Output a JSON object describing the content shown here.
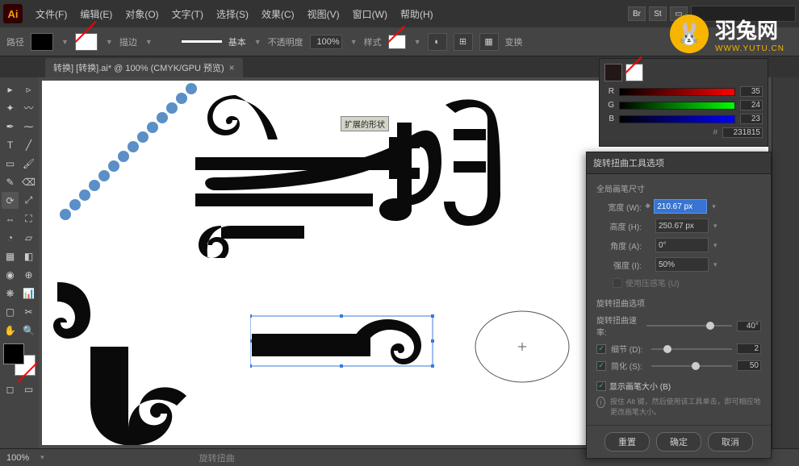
{
  "app": {
    "icon_label": "Ai"
  },
  "menus": {
    "file": "文件(F)",
    "edit": "编辑(E)",
    "object": "对象(O)",
    "type": "文字(T)",
    "select": "选择(S)",
    "effect": "效果(C)",
    "view": "视图(V)",
    "window": "窗口(W)",
    "help": "帮助(H)"
  },
  "top_icons": {
    "br": "Br",
    "st": "St"
  },
  "control": {
    "label": "路径",
    "stroke_label": "描边",
    "stroke_style": "基本",
    "opacity_label": "不透明度",
    "opacity_value": "100%",
    "style_label": "样式",
    "transform_label": "变换"
  },
  "tab": {
    "title": "转换] [转换].ai* @ 100% (CMYK/GPU 预览)",
    "close": "×"
  },
  "tooltip": {
    "text": "扩展的形状"
  },
  "color_panel": {
    "rows": [
      {
        "label": "R",
        "grad": "linear-gradient(to right,#000,#f00)",
        "value": "35"
      },
      {
        "label": "G",
        "grad": "linear-gradient(to right,#000,#0f0)",
        "value": "24"
      },
      {
        "label": "B",
        "grad": "linear-gradient(to right,#000,#00f)",
        "value": "23"
      }
    ],
    "hex": "231815"
  },
  "dialog": {
    "title": "旋转扭曲工具选项",
    "section1": "全局画笔尺寸",
    "width_label": "宽度 (W):",
    "width_value": "210.67 px",
    "height_label": "高度 (H):",
    "height_value": "250.67 px",
    "angle_label": "角度 (A):",
    "angle_value": "0°",
    "intensity_label": "强度 (I):",
    "intensity_value": "50%",
    "pressure_label": "使用压感笔 (U)",
    "section2": "旋转扭曲选项",
    "twirl_rate_label": "旋转扭曲速率:",
    "twirl_rate_value": "40°",
    "detail_label": "细节 (D):",
    "detail_value": "2",
    "simplify_label": "简化 (S):",
    "simplify_value": "50",
    "show_brush_label": "显示画笔大小 (B)",
    "hint": "按住 Alt 键，然后使用该工具单击，即可相应地更改画笔大小。",
    "reset": "重置",
    "ok": "确定",
    "cancel": "取消"
  },
  "status": {
    "zoom": "100%",
    "tool_hint": "旋转扭曲"
  },
  "logo": {
    "text": "羽兔网",
    "url": "WWW.YUTU.CN"
  }
}
